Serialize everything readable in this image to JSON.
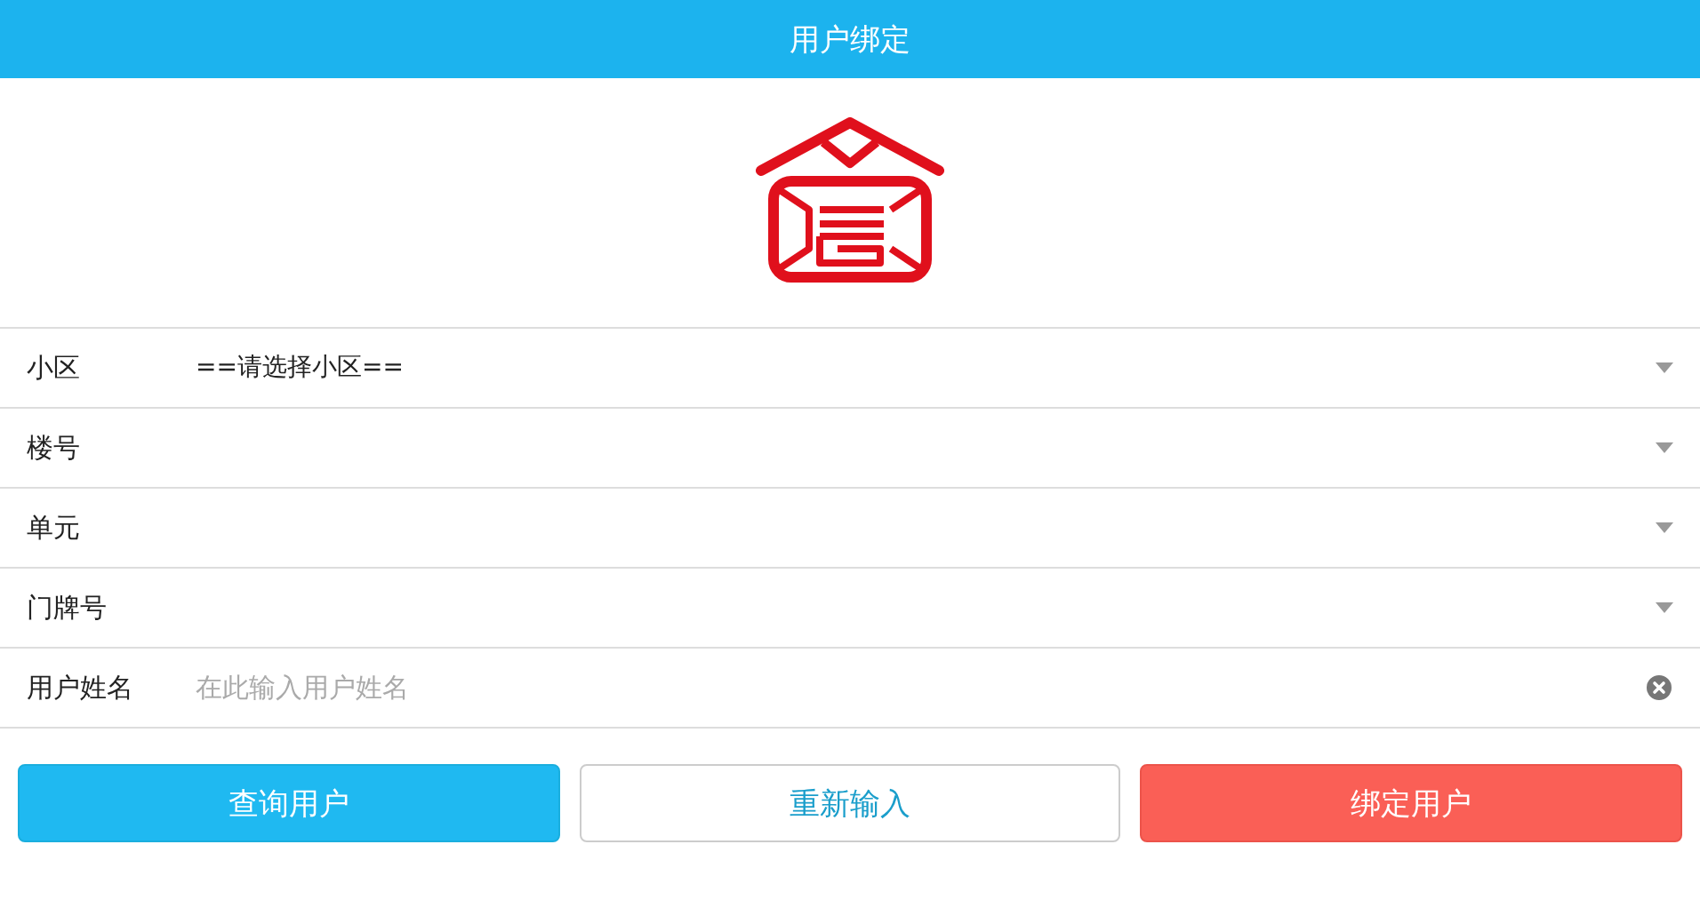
{
  "header": {
    "title": "用户绑定"
  },
  "fields": [
    {
      "kind": "select",
      "label": "小区",
      "value": "==请选择小区=="
    },
    {
      "kind": "select",
      "label": "楼号"
    },
    {
      "kind": "select",
      "label": "单元"
    },
    {
      "kind": "select",
      "label": "门牌号"
    },
    {
      "kind": "text",
      "label": "用户姓名",
      "placeholder": "在此输入用户姓名"
    }
  ],
  "buttons": [
    {
      "kind": "primary",
      "label": "查询用户"
    },
    {
      "kind": "default",
      "label": "重新输入"
    },
    {
      "kind": "danger",
      "label": "绑定用户"
    }
  ]
}
